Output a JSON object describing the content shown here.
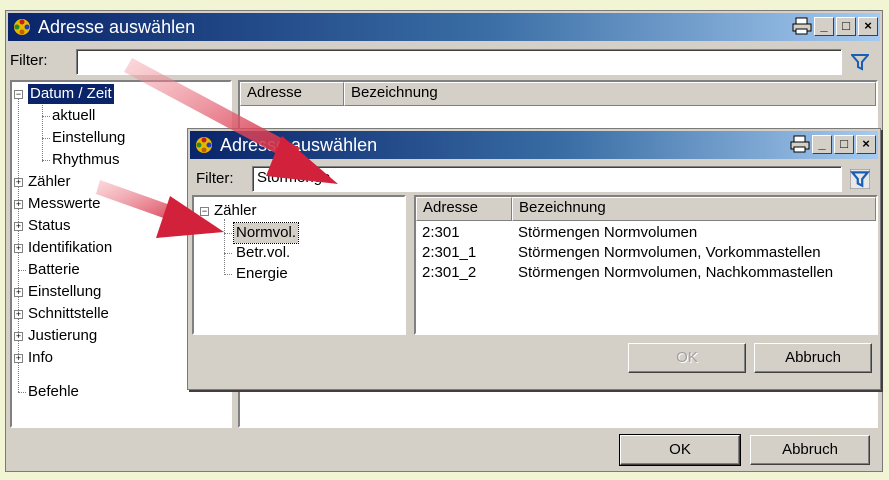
{
  "back_window": {
    "title": "Adresse auswählen",
    "filter_label": "Filter:",
    "filter_value": "",
    "tree": [
      {
        "label": "Datum / Zeit",
        "expanded": true,
        "selected": true
      },
      {
        "label": "aktuell"
      },
      {
        "label": "Einstellung"
      },
      {
        "label": "Rhythmus"
      },
      {
        "label": "Zähler",
        "expandable": true
      },
      {
        "label": "Messwerte",
        "expandable": true
      },
      {
        "label": "Status",
        "expandable": true
      },
      {
        "label": "Identifikation",
        "expandable": true
      },
      {
        "label": "Batterie"
      },
      {
        "label": "Einstellung",
        "expandable": true
      },
      {
        "label": "Schnittstelle",
        "expandable": true
      },
      {
        "label": "Justierung",
        "expandable": true
      },
      {
        "label": "Info",
        "expandable": true
      },
      {
        "label": "Befehle"
      }
    ],
    "columns": [
      "Adresse",
      "Bezeichnung"
    ],
    "ok_label": "OK",
    "cancel_label": "Abbruch"
  },
  "front_window": {
    "title": "Adresse auswählen",
    "filter_label": "Filter:",
    "filter_value": "Störmenge",
    "tree": [
      {
        "label": "Zähler",
        "expanded": true
      },
      {
        "label": "Normvol.",
        "selected": true
      },
      {
        "label": "Betr.vol."
      },
      {
        "label": "Energie"
      }
    ],
    "columns": [
      "Adresse",
      "Bezeichnung"
    ],
    "rows": [
      {
        "adresse": "2:301",
        "bezeichnung": "Störmengen Normvolumen"
      },
      {
        "adresse": "2:301_1",
        "bezeichnung": "Störmengen Normvolumen, Vorkommastellen"
      },
      {
        "adresse": "2:301_2",
        "bezeichnung": "Störmengen Normvolumen, Nachkommastellen"
      }
    ],
    "ok_label": "OK",
    "cancel_label": "Abbruch"
  },
  "icons": {
    "app": "app-logo-icon",
    "print": "printer-icon",
    "minimize": "minimize-icon",
    "maximize": "maximize-icon",
    "close": "close-icon",
    "filter": "funnel-icon",
    "minimize_glyph": "_",
    "maximize_glyph": "□",
    "close_glyph": "×"
  },
  "colors": {
    "titlebar_start": "#0a246a",
    "titlebar_end": "#a6caf0",
    "selection": "#0a246a",
    "arrow": "#d2213a",
    "filter_icon": "#1a5fb4"
  }
}
